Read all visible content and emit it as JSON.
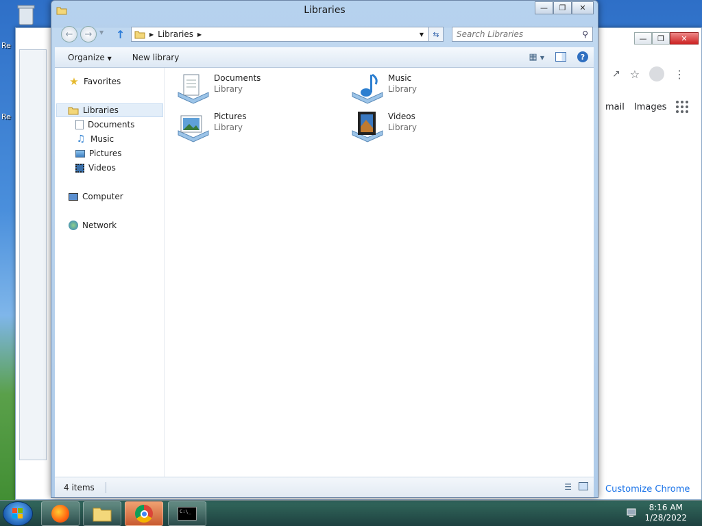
{
  "explorer": {
    "title": "Libraries",
    "address": {
      "segments": [
        "Libraries"
      ]
    },
    "search_placeholder": "Search Libraries",
    "commands": {
      "organize": "Organize",
      "new_library": "New library"
    },
    "nav": {
      "favorites": "Favorites",
      "libraries": "Libraries",
      "children": [
        "Documents",
        "Music",
        "Pictures",
        "Videos"
      ],
      "computer": "Computer",
      "network": "Network"
    },
    "items": [
      {
        "name": "Documents",
        "type": "Library"
      },
      {
        "name": "Music",
        "type": "Library"
      },
      {
        "name": "Pictures",
        "type": "Library"
      },
      {
        "name": "Videos",
        "type": "Library"
      }
    ],
    "status": "4 items"
  },
  "chrome": {
    "links": {
      "gmail": "mail",
      "images": "Images"
    },
    "customize": "Customize Chrome"
  },
  "taskbar": {
    "clock_time": "8:16 AM",
    "clock_date": "1/28/2022"
  },
  "desktop": {
    "label_a": "Re",
    "label_b": "Re"
  }
}
